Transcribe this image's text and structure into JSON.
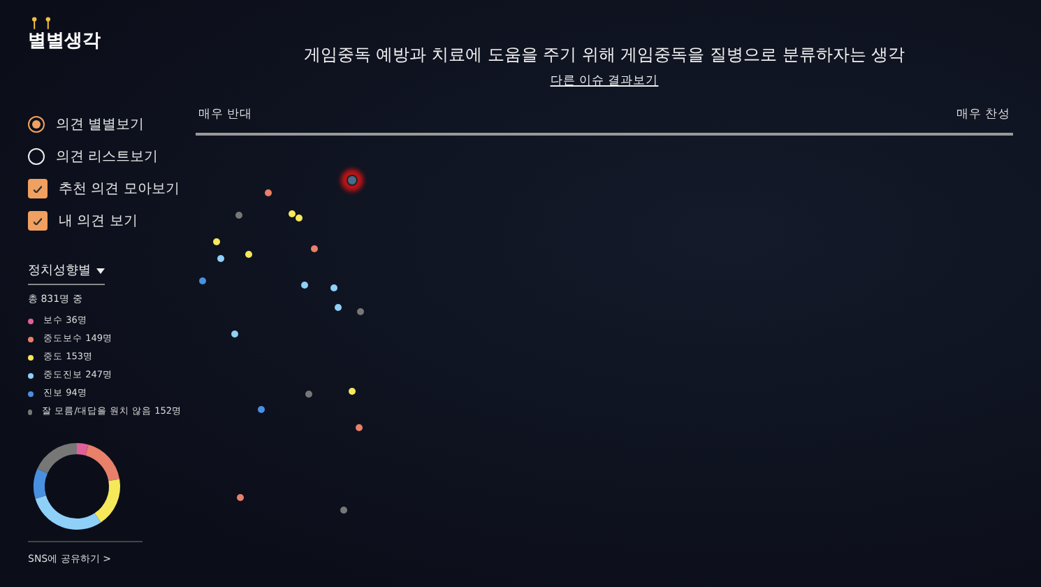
{
  "logo": {
    "text": "별별생각"
  },
  "header": {
    "title": "게임중독 예방과 치료에 도움을 주기 위해 게임중독을 질병으로 분류하자는 생각",
    "link": "다른 이슈 결과보기"
  },
  "view_options": [
    {
      "kind": "radio",
      "label": "의견 별별보기",
      "checked": true
    },
    {
      "kind": "radio",
      "label": "의견 리스트보기",
      "checked": false
    },
    {
      "kind": "checkbox",
      "label": "추천 의견 모아보기",
      "checked": true
    },
    {
      "kind": "checkbox",
      "label": "내 의견 보기",
      "checked": true
    }
  ],
  "filter": {
    "label": "정치성향별",
    "total": "총 831명 중"
  },
  "legend": [
    {
      "label": "보수 36명",
      "color": "#e0609a"
    },
    {
      "label": "중도보수 149명",
      "color": "#e8806a"
    },
    {
      "label": "중도 153명",
      "color": "#f5e85a"
    },
    {
      "label": "중도진보 247명",
      "color": "#8fd0f8"
    },
    {
      "label": "진보 94명",
      "color": "#4a90e0"
    },
    {
      "label": "잘 모름/대답을 원치 않음 152명",
      "color": "#777777"
    }
  ],
  "share_link": "SNS에 공유하기 >",
  "scale": {
    "left": "매우 반대",
    "right": "매우 찬성"
  },
  "dots": [
    {
      "color": "#4a6a8a",
      "selected": true
    },
    {
      "color": "#e8806a",
      "selected": false
    },
    {
      "color": "#777777",
      "selected": false
    },
    {
      "color": "#f5e85a",
      "selected": false
    },
    {
      "color": "#f5e85a",
      "selected": false
    },
    {
      "color": "#f5e85a",
      "selected": false
    },
    {
      "color": "#8fd0f8",
      "selected": false
    },
    {
      "color": "#f5e85a",
      "selected": false
    },
    {
      "color": "#e8806a",
      "selected": false
    },
    {
      "color": "#4a90e0",
      "selected": false
    },
    {
      "color": "#8fd0f8",
      "selected": false
    },
    {
      "color": "#8fd0f8",
      "selected": false
    },
    {
      "color": "#8fd0f8",
      "selected": false
    },
    {
      "color": "#777777",
      "selected": false
    },
    {
      "color": "#8fd0f8",
      "selected": false
    },
    {
      "color": "#777777",
      "selected": false
    },
    {
      "color": "#f5e85a",
      "selected": false
    },
    {
      "color": "#4a90e0",
      "selected": false
    },
    {
      "color": "#e8806a",
      "selected": false
    },
    {
      "color": "#e8806a",
      "selected": false
    },
    {
      "color": "#777777",
      "selected": false
    }
  ]
}
